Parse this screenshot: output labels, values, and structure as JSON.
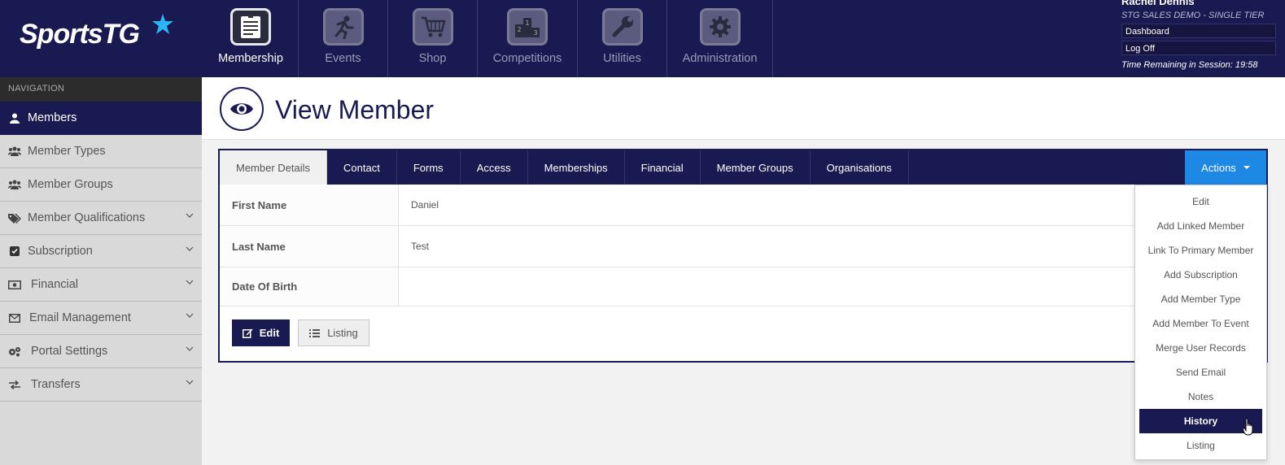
{
  "brand": {
    "name": "SportsTG"
  },
  "top_nav": [
    {
      "label": "Membership",
      "icon": "membership-clipboard-icon",
      "active": true
    },
    {
      "label": "Events",
      "icon": "runner-icon",
      "active": false
    },
    {
      "label": "Shop",
      "icon": "shopping-cart-icon",
      "active": false
    },
    {
      "label": "Competitions",
      "icon": "podium-icon",
      "active": false
    },
    {
      "label": "Utilities",
      "icon": "wrench-icon",
      "active": false
    },
    {
      "label": "Administration",
      "icon": "gear-icon",
      "active": false
    }
  ],
  "user": {
    "name": "Rachel Dennis",
    "org": "STG SALES DEMO - SINGLE TIER",
    "links": [
      "Dashboard",
      "Log Off"
    ],
    "session": "Time Remaining in Session: 19:58"
  },
  "sidebar": {
    "heading": "NAVIGATION",
    "items": [
      {
        "label": "Members",
        "icon": "user-icon",
        "active": true,
        "expandable": false
      },
      {
        "label": "Member Types",
        "icon": "users-icon",
        "active": false,
        "expandable": false
      },
      {
        "label": "Member Groups",
        "icon": "users-icon",
        "active": false,
        "expandable": false
      },
      {
        "label": "Member Qualifications",
        "icon": "tags-icon",
        "active": false,
        "expandable": true
      },
      {
        "label": "Subscription",
        "icon": "check-square-icon",
        "active": false,
        "expandable": true
      },
      {
        "label": "Financial",
        "icon": "money-icon",
        "active": false,
        "expandable": true
      },
      {
        "label": "Email Management",
        "icon": "envelope-icon",
        "active": false,
        "expandable": true
      },
      {
        "label": "Portal Settings",
        "icon": "cogs-icon",
        "active": false,
        "expandable": true
      },
      {
        "label": "Transfers",
        "icon": "exchange-icon",
        "active": false,
        "expandable": true
      }
    ]
  },
  "page": {
    "title": "View Member"
  },
  "tabs": [
    "Member Details",
    "Contact",
    "Forms",
    "Access",
    "Memberships",
    "Financial",
    "Member Groups",
    "Organisations"
  ],
  "actions": {
    "label": "Actions",
    "items": [
      "Edit",
      "Add Linked Member",
      "Link To Primary Member",
      "Add Subscription",
      "Add Member Type",
      "Add Member To Event",
      "Merge User Records",
      "Send Email",
      "Notes",
      "History",
      "Listing"
    ],
    "hovered": "History"
  },
  "details": [
    {
      "label": "First Name",
      "value": "Daniel"
    },
    {
      "label": "Last Name",
      "value": "Test"
    },
    {
      "label": "Date Of Birth",
      "value": ""
    }
  ],
  "buttons": {
    "edit": "Edit",
    "listing": "Listing"
  },
  "colors": {
    "navy": "#1a1a52",
    "accent": "#1e88e5",
    "logo_star": "#29b6f6"
  }
}
